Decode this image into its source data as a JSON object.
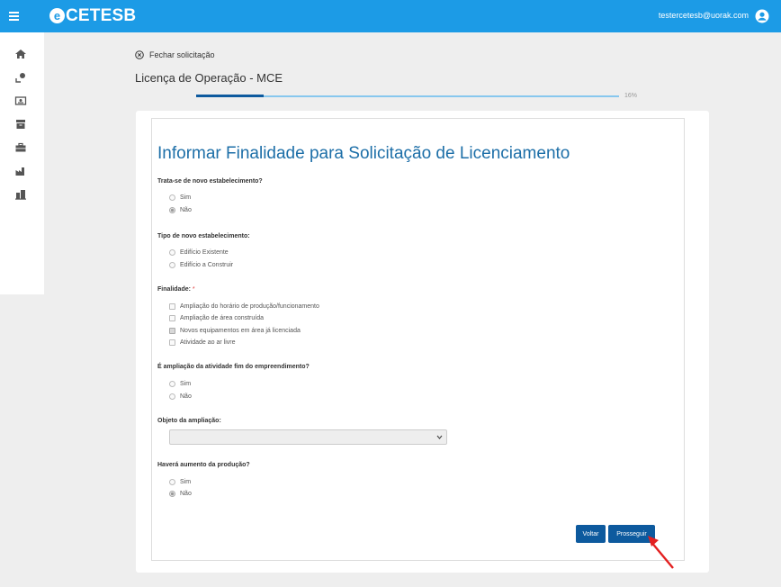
{
  "header": {
    "logo_text": "CETESB",
    "logo_mark": "e",
    "user_email": "testercetesb@uorak.com",
    "brand_color": "#1c9be6",
    "primary_color": "#0d5a9e"
  },
  "sidebar": {
    "items": [
      {
        "icon": "home-icon"
      },
      {
        "icon": "user-pin-icon"
      },
      {
        "icon": "id-card-icon"
      },
      {
        "icon": "archive-icon"
      },
      {
        "icon": "briefcase-icon"
      },
      {
        "icon": "factory-icon"
      },
      {
        "icon": "buildings-icon"
      }
    ]
  },
  "page": {
    "close_label": "Fechar solicitação",
    "title": "Licença de Operação - MCE",
    "progress": 0.16,
    "progress_label": "16%"
  },
  "form": {
    "heading": "Informar Finalidade para Solicitação de Licenciamento",
    "q1": {
      "label": "Trata-se de novo estabelecimento?",
      "options": [
        "Sim",
        "Não"
      ],
      "selected": "Não"
    },
    "q2": {
      "label": "Tipo de novo estabelecimento:",
      "options": [
        "Edifício Existente",
        "Edifício a Construir"
      ],
      "selected": null
    },
    "q3": {
      "label": "Finalidade:",
      "required_mark": "*",
      "options": [
        "Ampliação do horário de produção/funcionamento",
        "Ampliação de área construída",
        "Novos equipamentos em área já licenciada",
        "Atividade ao ar livre"
      ],
      "checked": [
        "Novos equipamentos em área já licenciada"
      ]
    },
    "q4": {
      "label": "É ampliação da atividade fim do empreendimento?",
      "options": [
        "Sim",
        "Não"
      ],
      "selected": null
    },
    "q5": {
      "label": "Objeto da ampliação:",
      "value": ""
    },
    "q6": {
      "label": "Haverá aumento da produção?",
      "options": [
        "Sim",
        "Não"
      ],
      "selected": "Não"
    },
    "back_label": "Voltar",
    "next_label": "Prosseguir"
  }
}
